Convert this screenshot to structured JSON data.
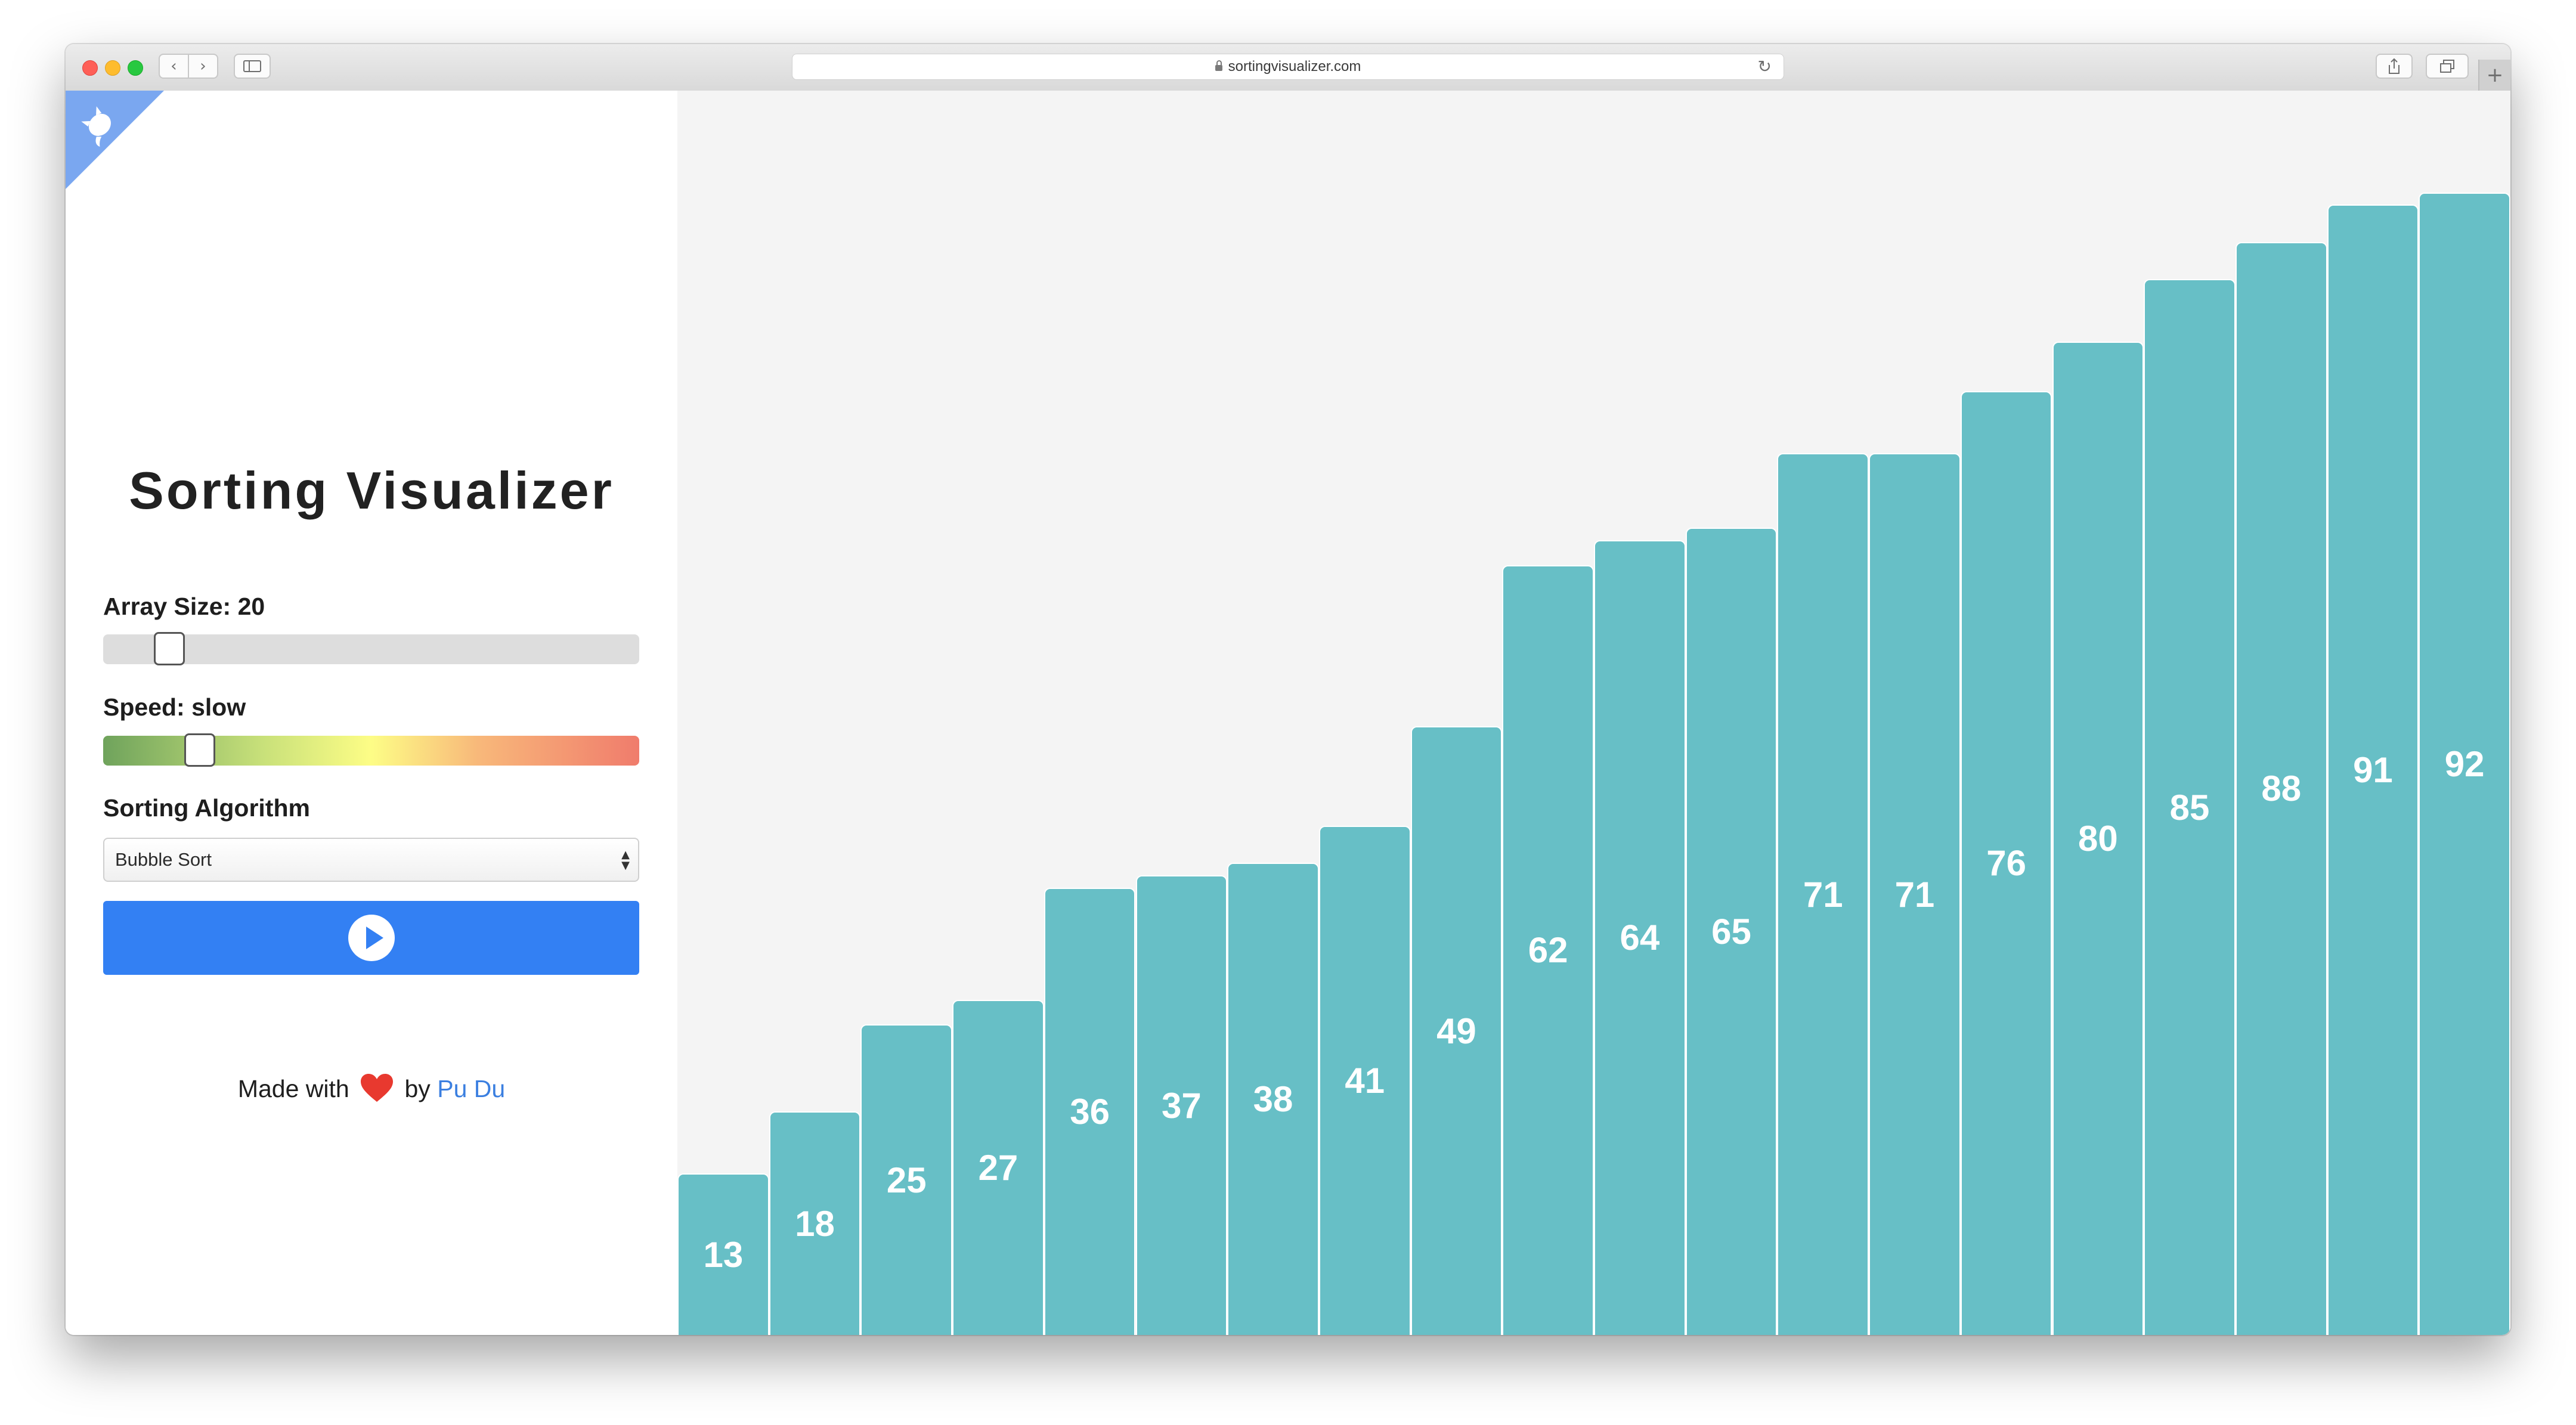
{
  "browser": {
    "url": "sortingvisualizer.com",
    "back_icon": "chevron-left-icon",
    "forward_icon": "chevron-right-icon",
    "sidebar_icon": "sidebar-icon",
    "reload_icon": "reload-icon",
    "share_icon": "share-icon",
    "tabs_icon": "tabs-icon",
    "new_tab_icon": "plus-icon"
  },
  "app": {
    "title": "Sorting Visualizer",
    "corner_icon": "github-octocat-icon",
    "array_size_label": "Array Size: 20",
    "array_size_value": 20,
    "array_size_fraction": 0.1,
    "speed_label": "Speed: slow",
    "speed_fraction": 0.16,
    "algorithm_label": "Sorting Algorithm",
    "algorithm_selected": "Bubble Sort",
    "play_icon": "play-icon",
    "footer": {
      "made_with": "Made with",
      "heart_icon": "heart-icon",
      "by": "by",
      "author": "Pu Du"
    },
    "colors": {
      "accent": "#3380f3",
      "bar": "#67bfc6",
      "heart": "#e8392f",
      "link": "#3b7fe0"
    }
  },
  "chart_data": {
    "type": "bar",
    "values": [
      13,
      18,
      25,
      27,
      36,
      37,
      38,
      41,
      49,
      62,
      64,
      65,
      71,
      71,
      76,
      80,
      85,
      88,
      91,
      92
    ],
    "data_labels": [
      "13",
      "18",
      "25",
      "27",
      "36",
      "37",
      "38",
      "41",
      "49",
      "62",
      "64",
      "65",
      "71",
      "71",
      "76",
      "80",
      "85",
      "88",
      "91",
      "92"
    ],
    "ylim": [
      0,
      100
    ]
  }
}
